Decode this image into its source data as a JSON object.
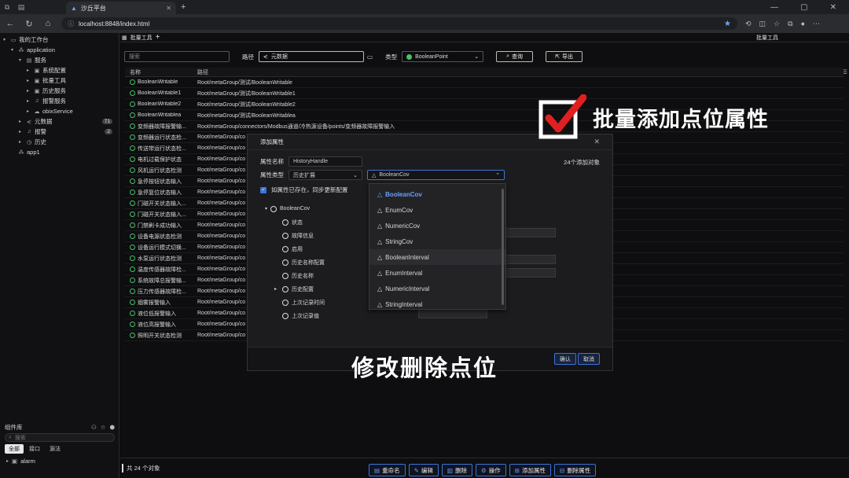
{
  "browser": {
    "tab_title": "沙丘平台",
    "url": "localhost:8848/index.html"
  },
  "sidebar": {
    "items": [
      {
        "label": "我的工作台",
        "icon": "monitor-icon",
        "caret": "▾",
        "level": 0
      },
      {
        "label": "application",
        "icon": "app-icon",
        "caret": "▾",
        "level": 1
      },
      {
        "label": "服务",
        "icon": "server-icon",
        "caret": "▾",
        "level": 2
      },
      {
        "label": "系统配置",
        "icon": "folder-icon",
        "caret": "▸",
        "level": 3
      },
      {
        "label": "批量工具",
        "icon": "folder-icon",
        "caret": "▸",
        "level": 3
      },
      {
        "label": "历史服务",
        "icon": "folder-icon",
        "caret": "▸",
        "level": 3
      },
      {
        "label": "报警服务",
        "icon": "bell-icon",
        "caret": "▸",
        "level": 3
      },
      {
        "label": "obixService",
        "icon": "cloud-icon",
        "caret": "▸",
        "level": 3
      },
      {
        "label": "元数据",
        "icon": "share-icon",
        "caret": "▸",
        "level": 2,
        "badge": "71"
      },
      {
        "label": "报警",
        "icon": "bell-icon",
        "caret": "▸",
        "level": 2,
        "badge": "2"
      },
      {
        "label": "历史",
        "icon": "clock-icon",
        "caret": "▸",
        "level": 2
      },
      {
        "label": "app1",
        "icon": "app-icon",
        "caret": "",
        "level": 1
      }
    ]
  },
  "library": {
    "title": "组件库",
    "search_placeholder": "搜索",
    "tabs": [
      "全部",
      "接口",
      "源法"
    ],
    "item": "alarm"
  },
  "main": {
    "tab": "批量工具",
    "right_tab": "批量工具",
    "search_placeholder": "搜索",
    "path_label": "路径",
    "path_value": "元数据",
    "type_label": "类型",
    "type_value": "BooleanPoint",
    "query_button": "查询",
    "export_button": "导出",
    "columns": [
      "名称",
      "路径"
    ],
    "rows": [
      [
        "BooleanWritable",
        "Root/metaGroup/测试/BooleanWritable"
      ],
      [
        "BooleanWritable1",
        "Root/metaGroup/测试/BooleanWritable1"
      ],
      [
        "BooleanWritable2",
        "Root/metaGroup/测试/BooleanWritable2"
      ],
      [
        "BooleanWritablea",
        "Root/metaGroup/测试/BooleanWritablea"
      ],
      [
        "变频器故障报警输...",
        "Root/metaGroup/connectors/Modbus通道/冷热源设备/points/变频器故障报警输入"
      ],
      [
        "变频器运行状态检...",
        "Root/metaGroup/co"
      ],
      [
        "传送带运行状态检...",
        "Root/metaGroup/co"
      ],
      [
        "电机过载保护状态",
        "Root/metaGroup/co"
      ],
      [
        "风机运行状态检测",
        "Root/metaGroup/co"
      ],
      [
        "急停按钮状态输入",
        "Root/metaGroup/co"
      ],
      [
        "急停复位状态输入",
        "Root/metaGroup/co"
      ],
      [
        "门磁开关状态输入...",
        "Root/metaGroup/co"
      ],
      [
        "门磁开关状态输入...",
        "Root/metaGroup/co"
      ],
      [
        "门禁刷卡成功输入",
        "Root/metaGroup/co"
      ],
      [
        "设备电源状态检测",
        "Root/metaGroup/co"
      ],
      [
        "设备运行模式切换...",
        "Root/metaGroup/co"
      ],
      [
        "水泵运行状态检测",
        "Root/metaGroup/co"
      ],
      [
        "温度传感器故障检...",
        "Root/metaGroup/co"
      ],
      [
        "系统故障总报警输...",
        "Root/metaGroup/co"
      ],
      [
        "压力传感器故障检...",
        "Root/metaGroup/co"
      ],
      [
        "烟雾报警输入",
        "Root/metaGroup/co"
      ],
      [
        "液位低报警输入",
        "Root/metaGroup/co"
      ],
      [
        "液位高报警输入",
        "Root/metaGroup/co"
      ],
      [
        "照明开关状态检测",
        "Root/metaGroup/co"
      ]
    ],
    "status_count": "共 24 个对象",
    "actions": [
      {
        "label": "重命名",
        "icon": "rename-icon"
      },
      {
        "label": "编辑",
        "icon": "edit-icon"
      },
      {
        "label": "删除",
        "icon": "trash-icon"
      },
      {
        "label": "操作",
        "icon": "gear-icon"
      },
      {
        "label": "添加属性",
        "icon": "add-icon"
      },
      {
        "label": "删除属性",
        "icon": "remove-icon"
      }
    ]
  },
  "dialog": {
    "title": "添加属性",
    "name_label": "属性名称",
    "name_value": "HistoryHandle",
    "target_count": "24个添加对象",
    "type_label": "属性类型",
    "type_category": "历史扩展",
    "type_value": "BooleanCov",
    "sync_label": "如属性已存在，同步更新配置",
    "tree_root": "BooleanCov",
    "tree_items": [
      "状态",
      "故障信息",
      "启用",
      "历史名称配置",
      "历史名称",
      "历史配置",
      "上次记录时间",
      "上次记录值"
    ],
    "ok_button": "确认",
    "cancel_button": "取消"
  },
  "dropdown": {
    "options": [
      "BooleanCov",
      "EnumCov",
      "NumericCov",
      "StringCov",
      "BooleanInterval",
      "EnumInterval",
      "NumericInterval",
      "StringInterval"
    ],
    "selected": "BooleanCov"
  },
  "captions": {
    "headline": "批量添加点位属性",
    "subtitle": "修改删除点位"
  },
  "colors": {
    "accent": "#3c74d8",
    "status_green": "#45c26a",
    "logo_red": "#e02020"
  }
}
